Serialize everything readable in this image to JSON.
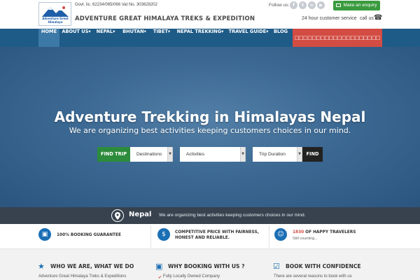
{
  "header": {
    "logo_text": "Adventure Great Himalaya",
    "govt_line": "Govt. lic. 62234/065/066 Vat No. 303628202",
    "company_name": "ADVENTURE GREAT HIMALAYA TREKS & EXPEDITION",
    "follow_label": "Follow us:",
    "social_icons": [
      "facebook-icon",
      "twitter-icon",
      "tripadvisor-icon",
      "youtube-icon"
    ],
    "enquiry_label": "Make an enquiry",
    "service_label": "24 hour customer service",
    "call_label": "call us",
    "colors": {
      "brand_blue": "#1f5b87",
      "accent_green": "#3a9b3e",
      "accent_red": "#d24c43"
    }
  },
  "nav": {
    "items": [
      {
        "label": "HOME",
        "active": true
      },
      {
        "label": "ABOUT US▾"
      },
      {
        "label": "NEPAL▾"
      },
      {
        "label": "BHUTAN▾"
      },
      {
        "label": "TIBET▾"
      },
      {
        "label": "NEPAL TREKKING▾"
      },
      {
        "label": "TRAVEL GUIDE▾"
      },
      {
        "label": "BLOG"
      }
    ],
    "highlight_label": "□□□□□□□□□□□□□□□□□□□□"
  },
  "hero": {
    "title": "Adventure Trekking in Himalayas Nepal",
    "subtitle": "We are organizing best activities keeping customers choices in our mind.",
    "search": {
      "find_trip_label": "FIND TRIP",
      "destinations": "Destinations",
      "activities": "Activities",
      "trip_duration": "Trip Duration",
      "find_label": "FIND"
    }
  },
  "strip": {
    "title": "Nepal",
    "text": "We are organizing best activities keeping customers choices in our mind."
  },
  "features": [
    {
      "text": "100% BOOKING GUARANTEE"
    },
    {
      "line1": "COMPETITIVE PRICE WITH FAIRNESS,",
      "line2": "HONEST AND RELIABLE."
    },
    {
      "count": "1830",
      "text": "OF HAPPY TRAVELERS",
      "small": "Still counting..."
    }
  ],
  "bottom": {
    "who": {
      "title": "WHO WE ARE, WHAT WE DO",
      "text": "Adventure Great Himalaya Treks & Expeditions"
    },
    "why": {
      "title": "WHY BOOKING WITH US ?",
      "text": "Fully Locally Owned Company"
    },
    "book": {
      "title": "BOOK WITH CONFIDENCE",
      "text": "There are several reasons to book with us"
    }
  }
}
